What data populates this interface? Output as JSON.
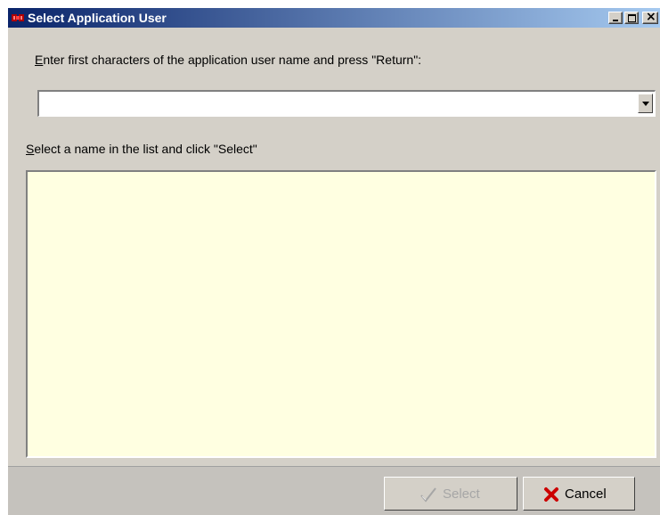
{
  "window": {
    "title": "Select Application User",
    "icon": "app-logo-icon",
    "controls": {
      "minimize_icon": "minimize-icon",
      "maximize_icon": "maximize-icon",
      "close_icon": "close-icon"
    }
  },
  "search": {
    "label_accel": "E",
    "label_rest": "nter first characters of the application user name and press \"Return\":",
    "value": ""
  },
  "list": {
    "label_accel": "S",
    "label_rest": "elect a name in the list and click \"Select\"",
    "items": []
  },
  "buttons": {
    "select_label": "Select",
    "select_icon": "checkmark-icon",
    "select_enabled": false,
    "cancel_label": "Cancel",
    "cancel_icon": "red-x-icon"
  },
  "colors": {
    "titlebar_start": "#0a246a",
    "titlebar_end": "#a6caf0",
    "list_background": "#ffffe1",
    "dialog_background": "#d4d0c8",
    "cancel_icon_color": "#cc0000"
  }
}
